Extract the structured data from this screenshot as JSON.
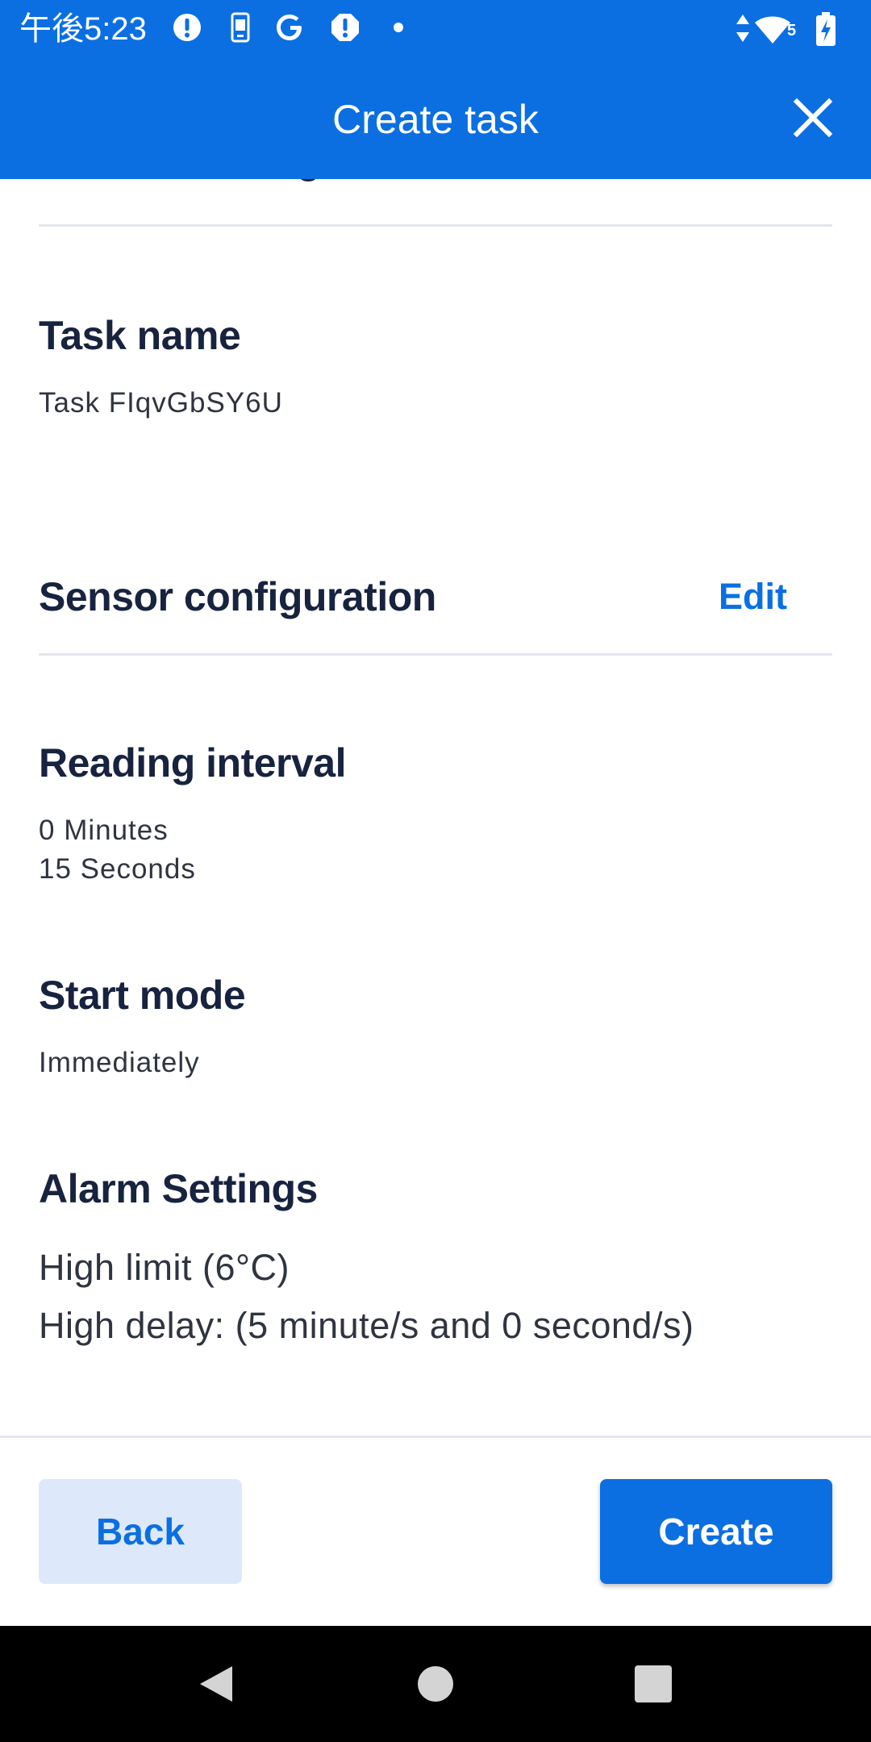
{
  "status_bar": {
    "time": "午後5:23",
    "network_badge": "5",
    "icons": [
      "alert-icon",
      "phone-device-icon",
      "google-icon",
      "alert-icon",
      "dot-icon",
      "data-arrows-icon",
      "wifi-icon",
      "battery-charging-icon"
    ]
  },
  "appbar": {
    "title": "Create task",
    "close_icon": "close-icon"
  },
  "content": {
    "cut_off_heading": "General settings",
    "task_name": {
      "title": "Task name",
      "value": "Task FIqvGbSY6U"
    },
    "sensor_configuration": {
      "title": "Sensor configuration",
      "edit_label": "Edit"
    },
    "reading_interval": {
      "title": "Reading interval",
      "minutes": "0 Minutes",
      "seconds": "15 Seconds"
    },
    "start_mode": {
      "title": "Start mode",
      "value": "Immediately"
    },
    "alarm_settings": {
      "title": "Alarm Settings",
      "high_limit": "High limit (6°C)",
      "high_delay": "High delay: (5 minute/s and 0 second/s)"
    }
  },
  "footer": {
    "back_label": "Back",
    "create_label": "Create"
  },
  "navigation": {
    "icons": [
      "back-triangle-icon",
      "home-circle-icon",
      "recents-square-icon"
    ]
  },
  "colors": {
    "primary": "#0b6fe2",
    "secondary_button_bg": "#dde9fb",
    "heading_text": "#17233f",
    "divider": "#e3e6eb"
  }
}
